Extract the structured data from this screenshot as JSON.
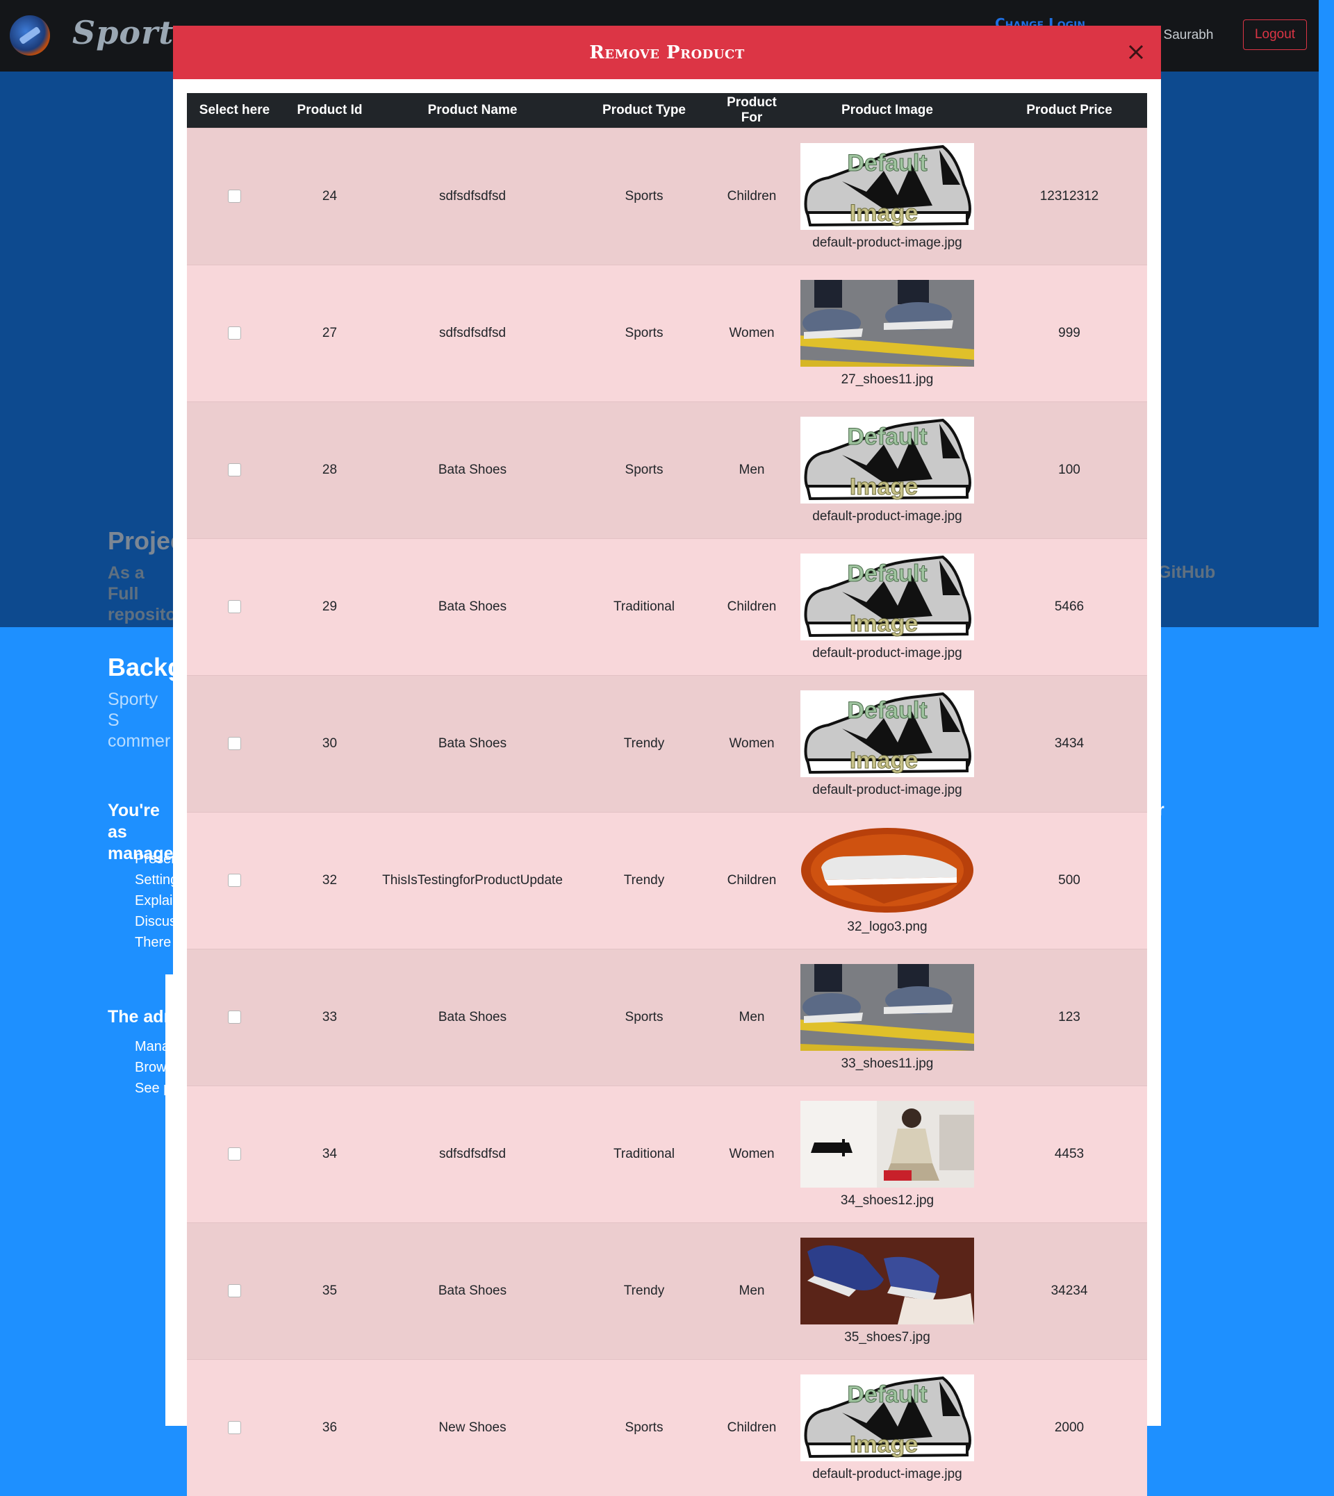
{
  "navbar": {
    "brand": "Sporty",
    "change_login": "Change Login",
    "user_greeting": ", Saurabh",
    "logout_label": "Logout"
  },
  "background": {
    "project_title": "Projec",
    "project_sub": "As a Full repositor",
    "project_github": "GitHub",
    "bg_heading": "Backg",
    "bg_para": "Sporty S commer",
    "assist_text": "You're as manager",
    "assist_right": "r",
    "list_items": [
      "Preser",
      "Setting",
      "Explair",
      "Discus",
      "There"
    ],
    "admin_heading": "The adr",
    "admin_items": [
      "Mana",
      "Brow",
      "See p"
    ]
  },
  "modal": {
    "title": "Remove Product",
    "close_label": "×"
  },
  "table": {
    "headers": [
      "Select here",
      "Product Id",
      "Product Name",
      "Product Type",
      "Product For",
      "Product Image",
      "Product Price"
    ],
    "rows": [
      {
        "id": "24",
        "name": "sdfsdfsdfsd",
        "type": "Sports",
        "for": "Children",
        "image": "default-product-image.jpg",
        "image_kind": "default",
        "price": "12312312"
      },
      {
        "id": "27",
        "name": "sdfsdfsdfsd",
        "type": "Sports",
        "for": "Women",
        "image": "27_shoes11.jpg",
        "image_kind": "street",
        "price": "999"
      },
      {
        "id": "28",
        "name": "Bata Shoes",
        "type": "Sports",
        "for": "Men",
        "image": "default-product-image.jpg",
        "image_kind": "default",
        "price": "100"
      },
      {
        "id": "29",
        "name": "Bata Shoes",
        "type": "Traditional",
        "for": "Children",
        "image": "default-product-image.jpg",
        "image_kind": "default",
        "price": "5466"
      },
      {
        "id": "30",
        "name": "Bata Shoes",
        "type": "Trendy",
        "for": "Women",
        "image": "default-product-image.jpg",
        "image_kind": "default",
        "price": "3434"
      },
      {
        "id": "32",
        "name": "ThisIsTestingforProductUpdate",
        "type": "Trendy",
        "for": "Children",
        "image": "32_logo3.png",
        "image_kind": "logo",
        "price": "500"
      },
      {
        "id": "33",
        "name": "Bata Shoes",
        "type": "Sports",
        "for": "Men",
        "image": "33_shoes11.jpg",
        "image_kind": "street",
        "price": "123"
      },
      {
        "id": "34",
        "name": "sdfsdfsdfsd",
        "type": "Traditional",
        "for": "Women",
        "image": "34_shoes12.jpg",
        "image_kind": "store",
        "price": "4453"
      },
      {
        "id": "35",
        "name": "Bata Shoes",
        "type": "Trendy",
        "for": "Men",
        "image": "35_shoes7.jpg",
        "image_kind": "sneakers",
        "price": "34234"
      },
      {
        "id": "36",
        "name": "New Shoes",
        "type": "Sports",
        "for": "Children",
        "image": "default-product-image.jpg",
        "image_kind": "default",
        "price": "2000"
      }
    ]
  },
  "colors": {
    "modal_header": "#dc3545",
    "table_head": "#212529",
    "row_odd": "#eccdcf",
    "row_even": "#f8d7da",
    "hero": "#0d4a8f",
    "page": "#1e90ff"
  }
}
